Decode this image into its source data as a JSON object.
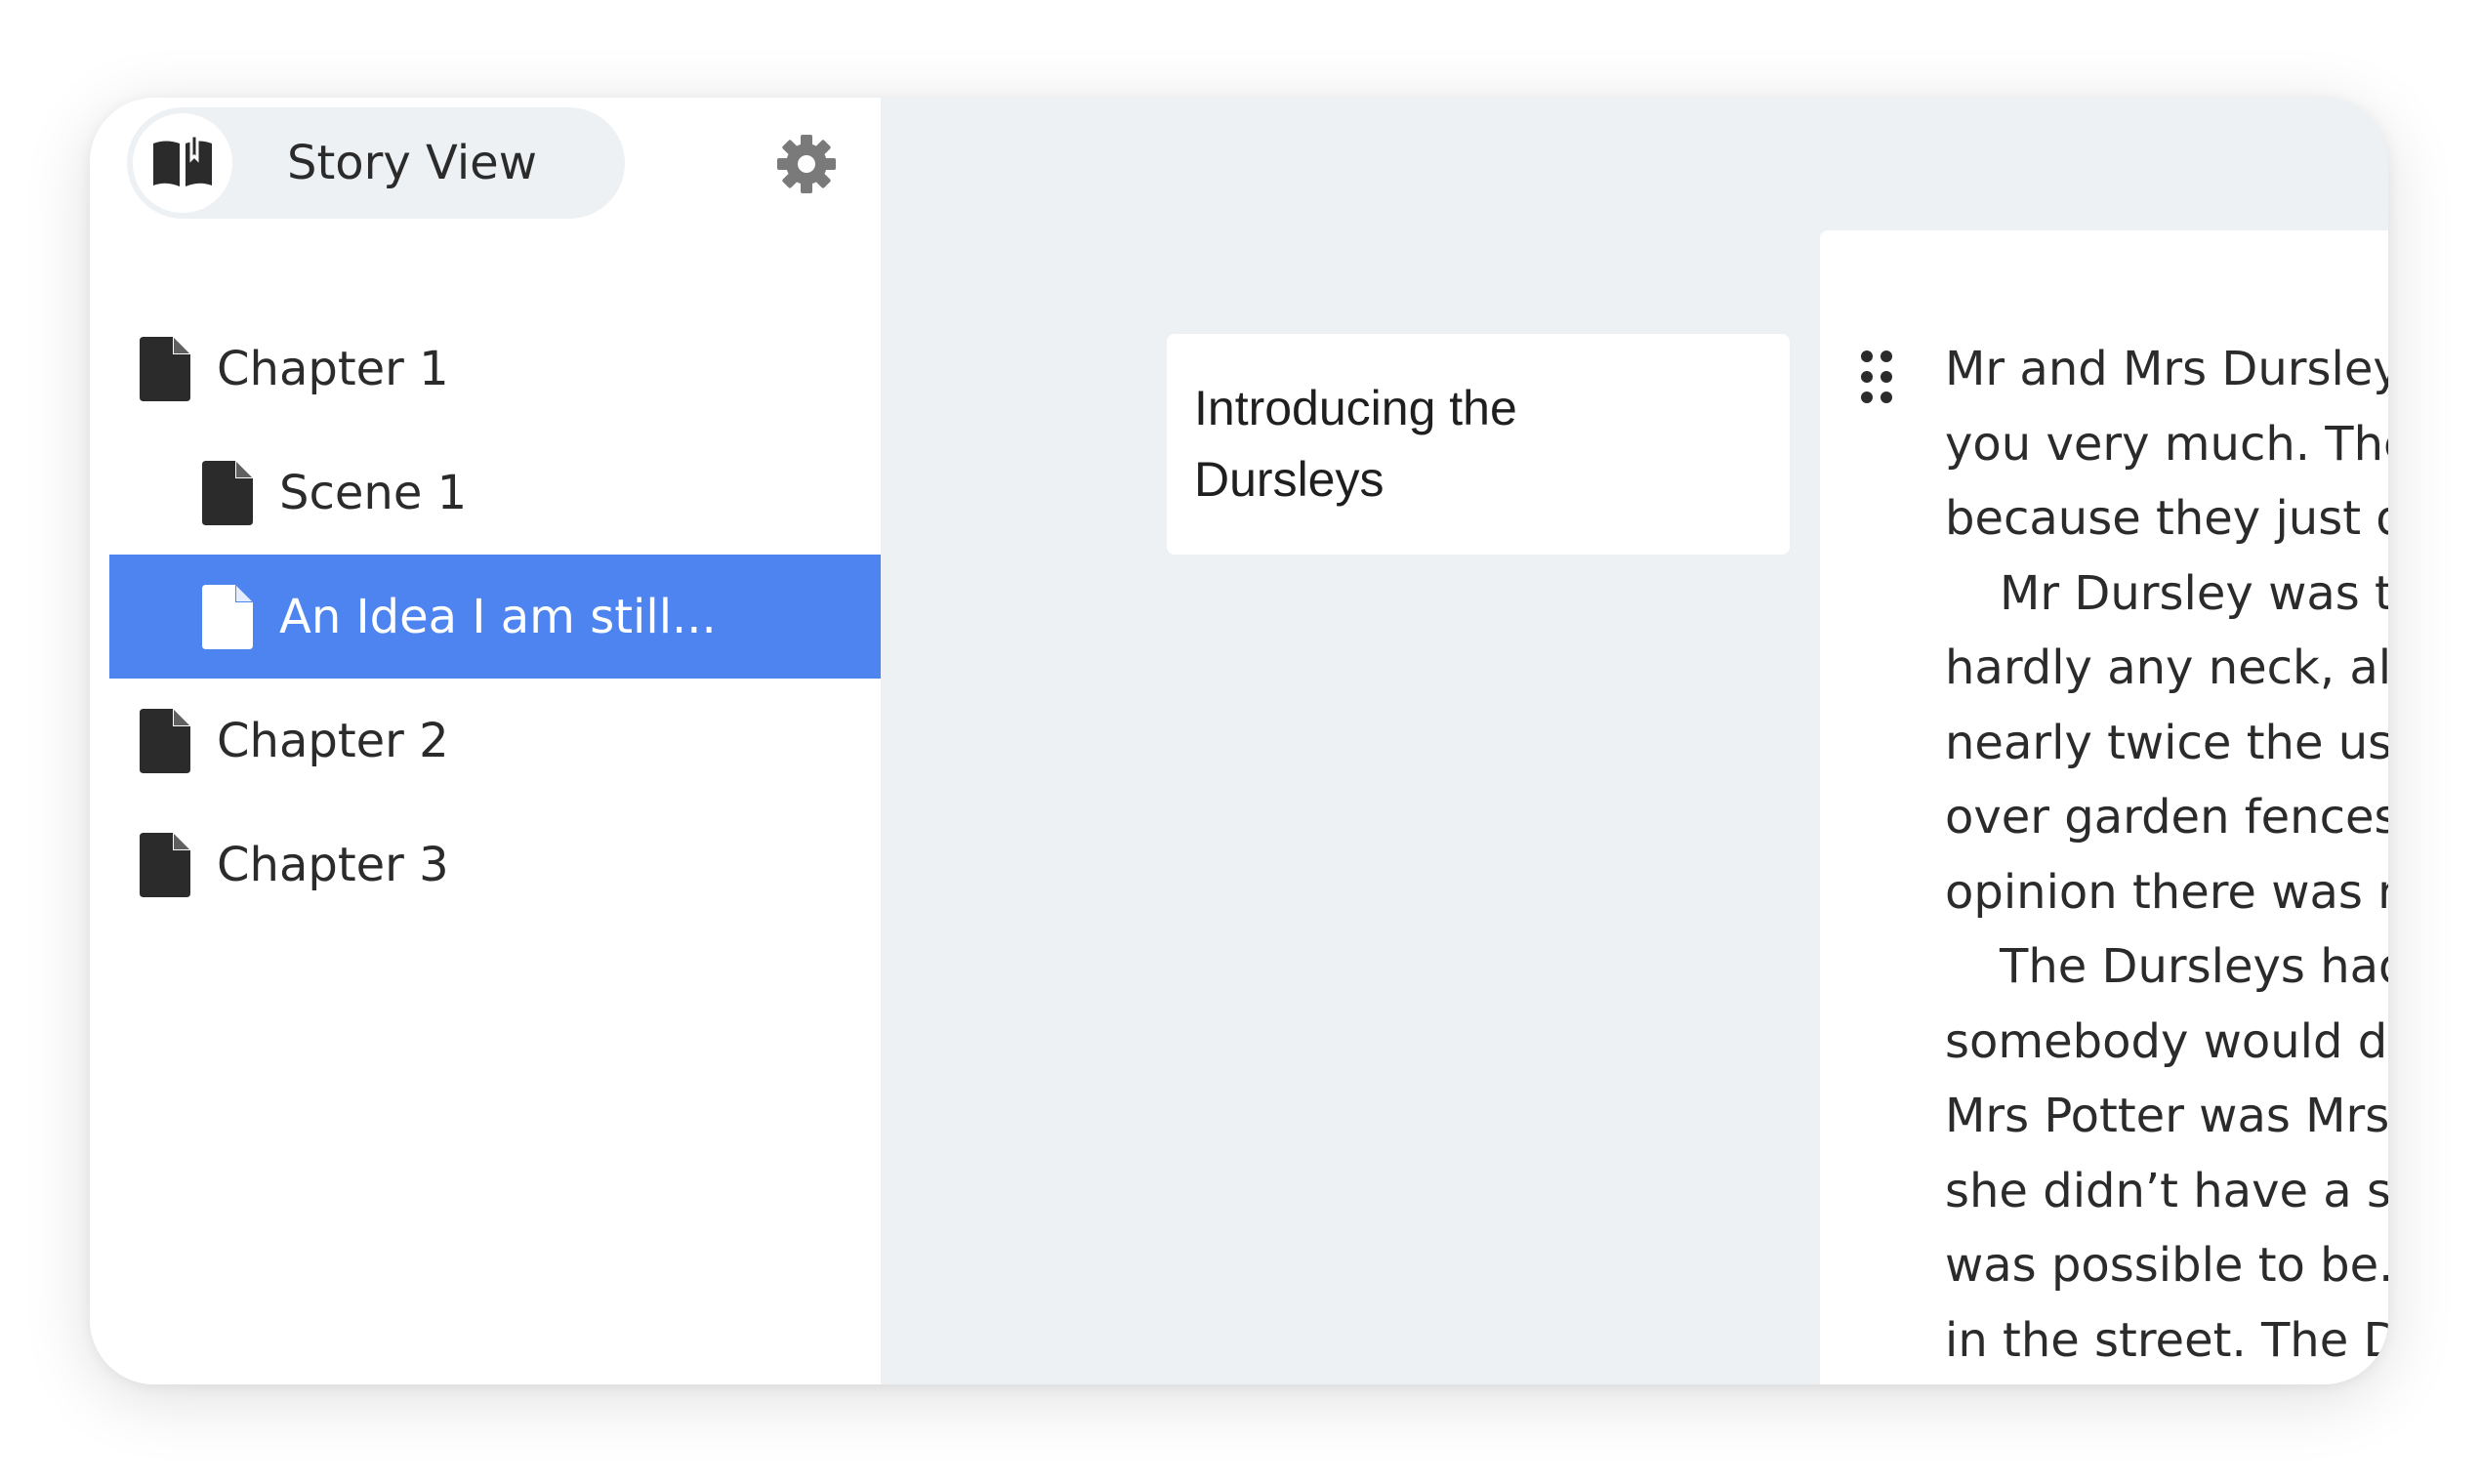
{
  "sidebar": {
    "view_switcher": {
      "label": "Story View",
      "icon": "open-book-icon"
    },
    "settings_icon": "gear-icon",
    "tree": [
      {
        "label": "Chapter 1",
        "icon": "document-icon",
        "level": 0,
        "active": false
      },
      {
        "label": "Scene 1",
        "icon": "document-icon",
        "level": 1,
        "active": false
      },
      {
        "label": "An Idea I am still...",
        "icon": "document-icon",
        "level": 1,
        "active": true
      },
      {
        "label": "Chapter 2",
        "icon": "document-icon",
        "level": 0,
        "active": false
      },
      {
        "label": "Chapter 3",
        "icon": "document-icon",
        "level": 0,
        "active": false
      }
    ]
  },
  "main": {
    "summary_card": {
      "line1": "Introducing the",
      "line2": "Dursleys"
    },
    "scene": {
      "drag_icon": "drag-handle-icon",
      "lines": [
        {
          "text": "Mr and Mrs Dursley,",
          "indent": false
        },
        {
          "text": "you very much. They",
          "indent": false
        },
        {
          "text": "because they just did",
          "indent": false
        },
        {
          "text": "Mr Dursley was th",
          "indent": true
        },
        {
          "text": "hardly any neck, alth",
          "indent": false
        },
        {
          "text": "nearly twice the usua",
          "indent": false
        },
        {
          "text": "over garden fences, ",
          "indent": false
        },
        {
          "text": "opinion there was no",
          "indent": false
        },
        {
          "text": "The Dursleys had ",
          "indent": true
        },
        {
          "text": "somebody would dis",
          "indent": false
        },
        {
          "text": "Mrs Potter was Mrs D",
          "indent": false
        },
        {
          "text": "she didn’t have a sis",
          "indent": false
        },
        {
          "text": "was possible to be. T",
          "indent": false
        },
        {
          "text": "in the street. The Du",
          "indent": false
        }
      ]
    }
  },
  "colors": {
    "accent": "#4d84f0",
    "background": "#eef1f4",
    "icon": "#2b2b2b",
    "settings_icon": "#7a7a7a"
  }
}
